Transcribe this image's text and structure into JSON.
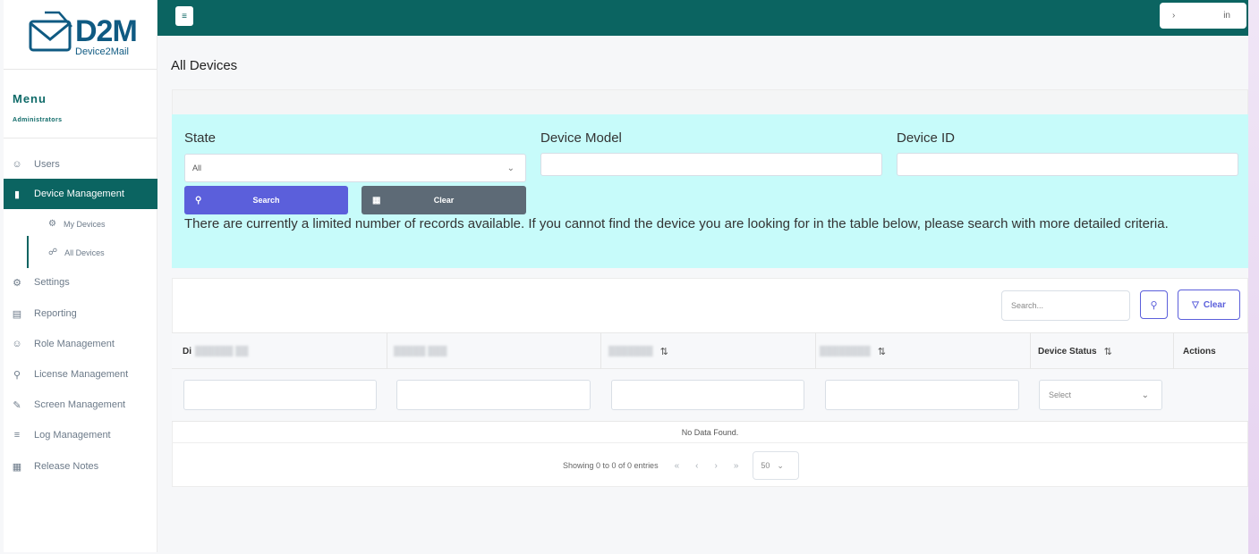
{
  "brand": {
    "name": "D2M",
    "subtitle": "Device2Mail"
  },
  "sidebar": {
    "menu_title": "Menu",
    "menu_subtitle": "Administrators",
    "items": [
      {
        "label": "Users",
        "icon": "user-icon"
      },
      {
        "label": "Device Management",
        "icon": "device-icon"
      },
      {
        "label": "My Devices",
        "icon": "gear-icon"
      },
      {
        "label": "All Devices",
        "icon": "devices-icon"
      },
      {
        "label": "Settings",
        "icon": "gear-icon"
      },
      {
        "label": "Reporting",
        "icon": "report-icon"
      },
      {
        "label": "Role Management",
        "icon": "user-icon"
      },
      {
        "label": "License Management",
        "icon": "key-icon"
      },
      {
        "label": "Screen Management",
        "icon": "pen-icon"
      },
      {
        "label": "Log Management",
        "icon": "list-icon"
      },
      {
        "label": "Release Notes",
        "icon": "notes-icon"
      }
    ]
  },
  "topbar": {
    "user_label": "in"
  },
  "page": {
    "title": "All Devices"
  },
  "filters": {
    "state_label": "State",
    "state_value": "All",
    "model_label": "Device Model",
    "model_value": "",
    "id_label": "Device ID",
    "id_value": "",
    "search_button": "Search",
    "clear_button": "Clear",
    "notice": "There are currently a limited number of records available. If you cannot find the device you are looking for in the table below, please search with more detailed criteria."
  },
  "table": {
    "search_placeholder": "Search...",
    "clear_label": "Clear",
    "columns": [
      "Di",
      "",
      "",
      "",
      "Device Status",
      "Actions"
    ],
    "status_select": "Select",
    "empty_message": "No Data Found.",
    "pager_text": "Showing 0 to 0 of 0 entries",
    "per_page": "50"
  },
  "colors": {
    "primary": "#0b6461",
    "accent": "#5b5fdb",
    "filter_bg": "#c7fbfa"
  }
}
